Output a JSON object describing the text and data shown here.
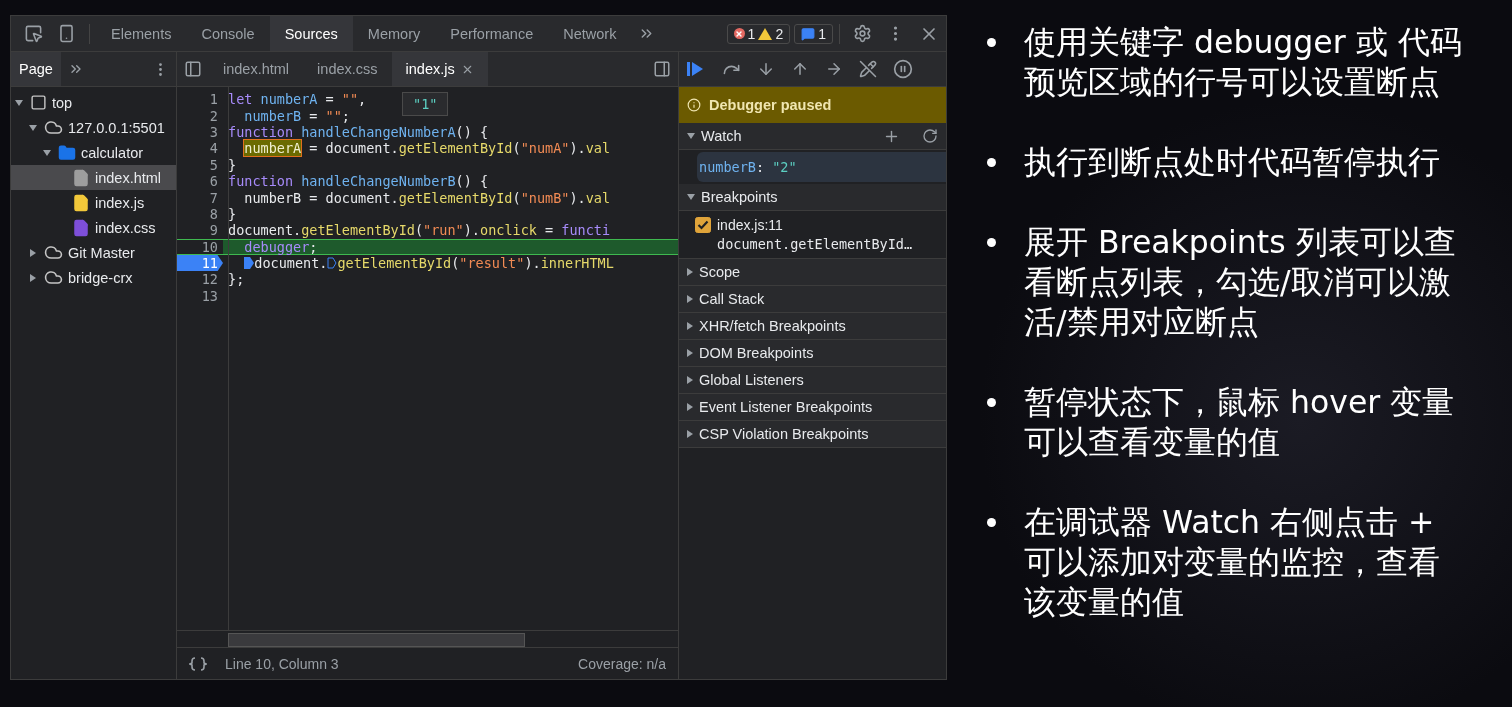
{
  "devtools": {
    "tabs": [
      {
        "label": "Elements",
        "selected": false
      },
      {
        "label": "Console",
        "selected": false
      },
      {
        "label": "Sources",
        "selected": true
      },
      {
        "label": "Memory",
        "selected": false
      },
      {
        "label": "Performance",
        "selected": false
      },
      {
        "label": "Network",
        "selected": false
      }
    ],
    "counters": {
      "errors": "1",
      "warnings": "2",
      "messages": "1"
    },
    "navigator": {
      "tab": "Page",
      "tree": [
        {
          "label": "top",
          "kind": "frame",
          "expanded": true,
          "selected": false,
          "children": [
            {
              "label": "127.0.0.1:5501",
              "kind": "cloud",
              "expanded": true,
              "selected": false,
              "children": [
                {
                  "label": "calculator",
                  "kind": "folder",
                  "expanded": true,
                  "selected": false,
                  "children": [
                    {
                      "label": "index.html",
                      "kind": "file",
                      "color": "#9e9e9e",
                      "selected": true
                    },
                    {
                      "label": "index.js",
                      "kind": "file",
                      "color": "#f2c83a",
                      "selected": false
                    },
                    {
                      "label": "index.css",
                      "kind": "file",
                      "color": "#7e4fd9",
                      "selected": false
                    }
                  ]
                }
              ]
            },
            {
              "label": "Git Master",
              "kind": "cloud",
              "expanded": false,
              "selected": false
            },
            {
              "label": "bridge-crx",
              "kind": "cloud",
              "expanded": false,
              "selected": false
            }
          ]
        }
      ]
    },
    "editor_tabs": [
      {
        "label": "index.html",
        "selected": false,
        "closable": false
      },
      {
        "label": "index.css",
        "selected": false,
        "closable": false
      },
      {
        "label": "index.js",
        "selected": true,
        "closable": true
      }
    ],
    "code_lines": [
      {
        "number": "1",
        "paused": false,
        "breakpoint": false,
        "indent": false,
        "segments": [
          {
            "kind": "keyword",
            "t": "let "
          },
          {
            "kind": "name",
            "t": "numberA"
          },
          {
            "kind": "plain",
            "t": " = "
          },
          {
            "kind": "string",
            "t": "\"\""
          },
          {
            "kind": "plain",
            "t": ","
          }
        ]
      },
      {
        "number": "2",
        "paused": false,
        "breakpoint": false,
        "indent": true,
        "segments": [
          {
            "kind": "name",
            "t": "numberB"
          },
          {
            "kind": "plain",
            "t": " = "
          },
          {
            "kind": "string",
            "t": "\"\""
          },
          {
            "kind": "plain",
            "t": ";"
          }
        ]
      },
      {
        "number": "3",
        "paused": false,
        "breakpoint": false,
        "indent": false,
        "segments": [
          {
            "kind": "keyword",
            "t": "function "
          },
          {
            "kind": "name",
            "t": "handleChangeNumberA"
          },
          {
            "kind": "plain",
            "t": "() {"
          }
        ]
      },
      {
        "number": "4",
        "paused": false,
        "breakpoint": false,
        "indent": true,
        "segments": [
          {
            "kind": "highlight",
            "t": "numberA"
          },
          {
            "kind": "plain",
            "t": " = document."
          },
          {
            "kind": "method",
            "t": "getElementById"
          },
          {
            "kind": "plain",
            "t": "("
          },
          {
            "kind": "string",
            "t": "\"numA\""
          },
          {
            "kind": "plain",
            "t": ")."
          },
          {
            "kind": "method",
            "t": "val"
          }
        ]
      },
      {
        "number": "5",
        "paused": false,
        "breakpoint": false,
        "indent": false,
        "segments": [
          {
            "kind": "plain",
            "t": "}"
          }
        ]
      },
      {
        "number": "6",
        "paused": false,
        "breakpoint": false,
        "indent": false,
        "segments": [
          {
            "kind": "keyword",
            "t": "function "
          },
          {
            "kind": "name",
            "t": "handleChangeNumberB"
          },
          {
            "kind": "plain",
            "t": "() {"
          }
        ]
      },
      {
        "number": "7",
        "paused": false,
        "breakpoint": false,
        "indent": true,
        "segments": [
          {
            "kind": "plain",
            "t": "numberB = document."
          },
          {
            "kind": "method",
            "t": "getElementById"
          },
          {
            "kind": "plain",
            "t": "("
          },
          {
            "kind": "string",
            "t": "\"numB\""
          },
          {
            "kind": "plain",
            "t": ")."
          },
          {
            "kind": "method",
            "t": "val"
          }
        ]
      },
      {
        "number": "8",
        "paused": false,
        "breakpoint": false,
        "indent": false,
        "segments": [
          {
            "kind": "plain",
            "t": "}"
          }
        ]
      },
      {
        "number": "9",
        "paused": false,
        "breakpoint": false,
        "indent": false,
        "segments": [
          {
            "kind": "plain",
            "t": "document."
          },
          {
            "kind": "method",
            "t": "getElementById"
          },
          {
            "kind": "plain",
            "t": "("
          },
          {
            "kind": "string",
            "t": "\"run\""
          },
          {
            "kind": "plain",
            "t": ")."
          },
          {
            "kind": "method",
            "t": "onclick"
          },
          {
            "kind": "plain",
            "t": " = "
          },
          {
            "kind": "keyword",
            "t": "functi"
          }
        ]
      },
      {
        "number": "10",
        "paused": true,
        "breakpoint": false,
        "indent": true,
        "segments": [
          {
            "kind": "keyword",
            "t": "debugger"
          },
          {
            "kind": "plain",
            "t": ";"
          }
        ]
      },
      {
        "number": "11",
        "paused": false,
        "breakpoint": true,
        "indent": true,
        "segments": [
          {
            "kind": "marker_on"
          },
          {
            "kind": "plain",
            "t": "document."
          },
          {
            "kind": "marker_off"
          },
          {
            "kind": "method",
            "t": "getElementById"
          },
          {
            "kind": "plain",
            "t": "("
          },
          {
            "kind": "string",
            "t": "\"result\""
          },
          {
            "kind": "plain",
            "t": ")."
          },
          {
            "kind": "method",
            "t": "innerHTML"
          }
        ]
      },
      {
        "number": "12",
        "paused": false,
        "breakpoint": false,
        "indent": false,
        "segments": [
          {
            "kind": "plain",
            "t": "};"
          }
        ]
      },
      {
        "number": "13",
        "paused": false,
        "breakpoint": false
      }
    ],
    "tooltip": "\"1\"",
    "status": {
      "position": "Line 10, Column 3",
      "coverage": "Coverage: n/a"
    },
    "debugger": {
      "banner": "Debugger paused",
      "watch": {
        "title": "Watch",
        "expanded": true,
        "expressions": [
          {
            "name": "numberB",
            "separator": ":",
            "value": "\"2\""
          }
        ]
      },
      "breakpoints": {
        "title": "Breakpoints",
        "expanded": true,
        "items": [
          {
            "file": "index.js:11",
            "code": "document.getElementById…",
            "checked": true
          }
        ]
      },
      "sections": [
        {
          "label": "Scope",
          "expanded": false
        },
        {
          "label": "Call Stack",
          "expanded": false
        },
        {
          "label": "XHR/fetch Breakpoints",
          "expanded": false
        },
        {
          "label": "DOM Breakpoints",
          "expanded": false
        },
        {
          "label": "Global Listeners",
          "expanded": false
        },
        {
          "label": "Event Listener Breakpoints",
          "expanded": false
        },
        {
          "label": "CSP Violation Breakpoints",
          "expanded": false
        }
      ]
    }
  },
  "slide": {
    "bullets": [
      "使用关键字 debugger 或 代码预览区域的行号可以设置断点",
      "执行到断点处时代码暂停执行",
      "展开 Breakpoints 列表可以查看断点列表，勾选/取消可以激活/禁用对应断点",
      "暂停状态下，鼠标 hover 变量可以查看变量的值",
      "在调试器 Watch 右侧点击 + 可以添加对变量的监控，查看该变量的值"
    ]
  }
}
